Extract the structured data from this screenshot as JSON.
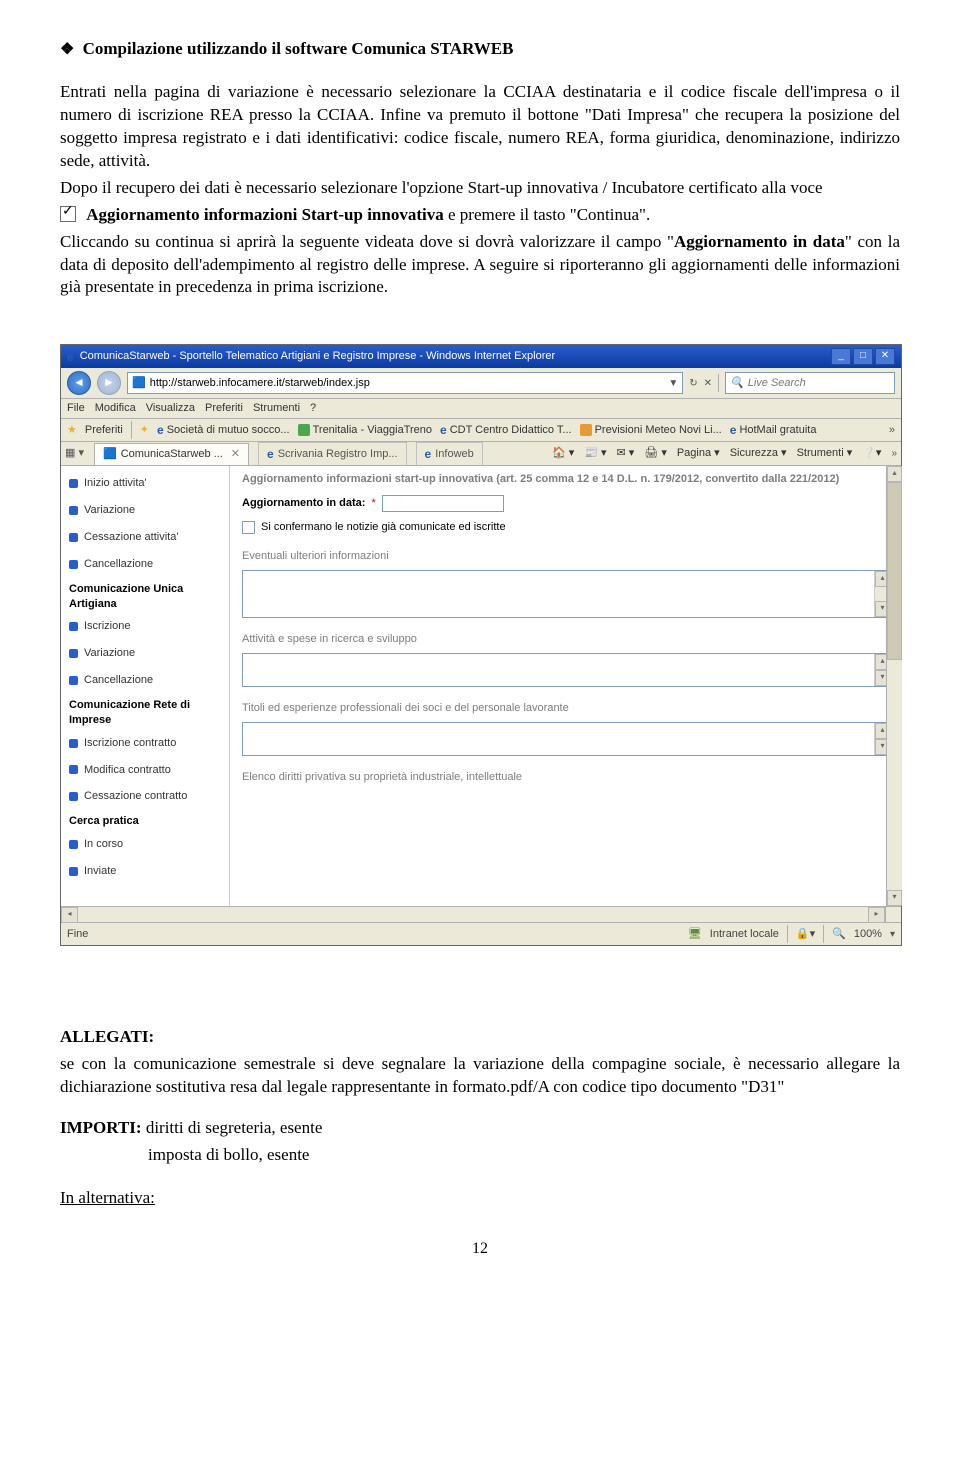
{
  "heading": {
    "bullet": "❖",
    "text": "Compilazione utilizzando il software Comunica STARWEB"
  },
  "p1": "Entrati nella pagina di variazione è necessario selezionare la CCIAA destinataria e il codice fiscale dell'impresa o il numero di iscrizione REA presso la CCIAA. Infine va premuto il bottone \"Dati Impresa\" che recupera la posizione del soggetto impresa registrato e i dati identificativi: codice fiscale, numero REA, forma giuridica, denominazione, indirizzo sede, attività.",
  "p2": "Dopo il recupero dei dati è necessario selezionare l'opzione Start-up innovativa / Incubatore certificato alla voce",
  "p3_bold": "Aggiornamento informazioni Start-up innovativa",
  "p3_tail": "  e premere il tasto \"Continua\".",
  "p4a": "Cliccando su continua si aprirà la seguente videata dove si dovrà valorizzare  il campo \"",
  "p4b_bold": "Aggiornamento in data",
  "p4c": "\" con la data di deposito dell'adempimento al registro delle imprese. A seguire si riporteranno gli aggiornamenti delle informazioni già presentate in precedenza in prima iscrizione.",
  "shot": {
    "title": "ComunicaStarweb - Sportello Telematico Artigiani e Registro Imprese - Windows Internet Explorer",
    "url": "http://starweb.infocamere.it/starweb/index.jsp",
    "search_placeholder": "Live Search",
    "menu": [
      "File",
      "Modifica",
      "Visualizza",
      "Preferiti",
      "Strumenti",
      "?"
    ],
    "fav_label": "Preferiti",
    "fav_items": [
      "Società di mutuo socco...",
      "Trenitalia - ViaggiaTreno",
      "CDT  Centro Didattico T...",
      "Previsioni Meteo Novi Li...",
      "HotMail gratuita"
    ],
    "tabs": [
      "ComunicaStarweb ...",
      "Scrivania Registro Imp...",
      "Infoweb"
    ],
    "tabtools": [
      "Pagina",
      "Sicurezza",
      "Strumenti"
    ],
    "sidebar": {
      "items1": [
        "Inizio attivita'",
        "Variazione",
        "Cessazione attivita'",
        "Cancellazione"
      ],
      "head1": "Comunicazione Unica Artigiana",
      "items2": [
        "Iscrizione",
        "Variazione",
        "Cancellazione"
      ],
      "head2": "Comunicazione Rete di Imprese",
      "items3": [
        "Iscrizione contratto",
        "Modifica contratto",
        "Cessazione contratto"
      ],
      "head3": "Cerca pratica",
      "items4": [
        "In corso",
        "Inviate"
      ]
    },
    "main": {
      "hd": "Aggiornamento informazioni start-up innovativa (art. 25 comma 12 e 14 D.L. n. 179/2012, convertito dalla 221/2012)",
      "lbl_date": "Aggiornamento in data:",
      "cb_text": "Si confermano le notizie già comunicate ed iscritte",
      "sec1": "Eventuali ulteriori informazioni",
      "sec2": "Attività e spese in ricerca e sviluppo",
      "sec3": "Titoli ed esperienze professionali dei soci e del personale lavorante",
      "sec4": "Elenco diritti privativa su proprietà industriale, intellettuale"
    },
    "status": {
      "left": "Fine",
      "zone": "Intranet locale",
      "zoom": "100%"
    }
  },
  "allegati": {
    "title": "ALLEGATI:",
    "text": "se con la comunicazione semestrale si deve segnalare la variazione della compagine sociale, è necessario allegare la dichiarazione sostitutiva resa dal legale rappresentante in formato.pdf/A con codice tipo documento \"D31\""
  },
  "importi": {
    "title": "IMPORTI:",
    "l1": " diritti di segreteria, esente",
    "l2": "imposta di bollo, esente"
  },
  "alt": "In alternativa:",
  "pagenum": "12"
}
